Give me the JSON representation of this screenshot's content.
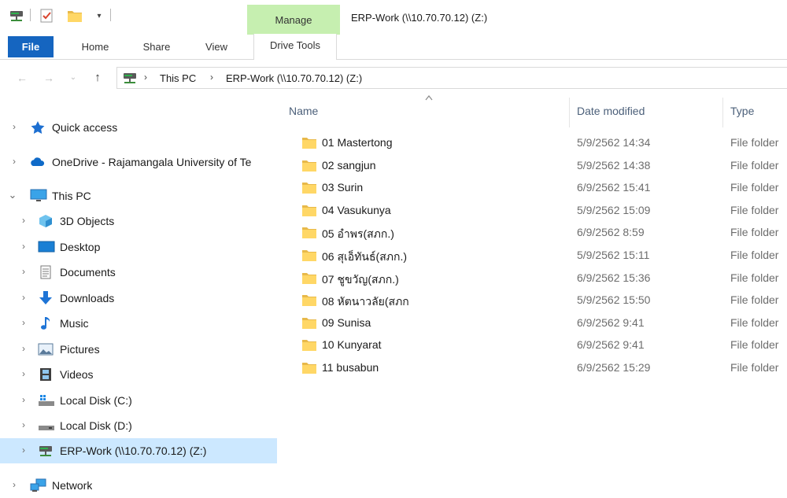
{
  "window": {
    "title": "ERP-Work (\\\\10.70.70.12) (Z:)",
    "contextual_tab_group": "Manage",
    "quick_access_toolbar": [
      "network-drive-icon",
      "properties-icon",
      "new-folder-icon",
      "customize-dropdown-icon"
    ]
  },
  "ribbon": {
    "tabs": [
      "File",
      "Home",
      "Share",
      "View",
      "Drive Tools"
    ],
    "active_color": "#1565c0",
    "contextual_color": "#c6efb0"
  },
  "address_bar": {
    "crumbs": [
      "This PC",
      "ERP-Work (\\\\10.70.70.12) (Z:)"
    ]
  },
  "nav_pane": {
    "items": [
      {
        "label": "Quick access",
        "icon": "star-icon",
        "expanded": false
      },
      {
        "label": "OneDrive - Rajamangala University of Te",
        "icon": "cloud-icon",
        "expanded": false
      },
      {
        "label": "This PC",
        "icon": "monitor-icon",
        "expanded": true
      },
      {
        "label": "3D Objects",
        "icon": "cube-icon",
        "expanded": false
      },
      {
        "label": "Desktop",
        "icon": "desktop-icon",
        "expanded": false
      },
      {
        "label": "Documents",
        "icon": "document-icon",
        "expanded": false
      },
      {
        "label": "Downloads",
        "icon": "download-arrow-icon",
        "expanded": false
      },
      {
        "label": "Music",
        "icon": "music-note-icon",
        "expanded": false
      },
      {
        "label": "Pictures",
        "icon": "picture-icon",
        "expanded": false
      },
      {
        "label": "Videos",
        "icon": "film-icon",
        "expanded": false
      },
      {
        "label": "Local Disk (C:)",
        "icon": "windows-drive-icon",
        "expanded": false
      },
      {
        "label": "Local Disk (D:)",
        "icon": "drive-icon",
        "expanded": false
      },
      {
        "label": "ERP-Work (\\\\10.70.70.12) (Z:)",
        "icon": "network-drive-icon",
        "expanded": false,
        "selected": true
      },
      {
        "label": "Network",
        "icon": "network-icon",
        "expanded": false
      }
    ],
    "selected_color": "#cce8ff"
  },
  "columns": {
    "name": "Name",
    "date": "Date modified",
    "type": "Type"
  },
  "files": [
    {
      "name": "01 Mastertong",
      "date": "5/9/2562 14:34",
      "type": "File folder"
    },
    {
      "name": "02 sangjun",
      "date": "5/9/2562 14:38",
      "type": "File folder"
    },
    {
      "name": "03 Surin",
      "date": "6/9/2562 15:41",
      "type": "File folder"
    },
    {
      "name": "04 Vasukunya",
      "date": "5/9/2562 15:09",
      "type": "File folder"
    },
    {
      "name": "05 อำพร(สภก.)",
      "date": "6/9/2562 8:59",
      "type": "File folder"
    },
    {
      "name": "06 สุเอ็ทันธ์(สภก.)",
      "date": "5/9/2562 15:11",
      "type": "File folder"
    },
    {
      "name": "07 ชูขวัญ(สภก.)",
      "date": "6/9/2562 15:36",
      "type": "File folder"
    },
    {
      "name": "08 หัตนาวลัย(สภก",
      "date": "5/9/2562 15:50",
      "type": "File folder"
    },
    {
      "name": "09 Sunisa",
      "date": "6/9/2562 9:41",
      "type": "File folder"
    },
    {
      "name": "10 Kunyarat",
      "date": "6/9/2562 9:41",
      "type": "File folder"
    },
    {
      "name": "11 busabun",
      "date": "6/9/2562 15:29",
      "type": "File folder"
    }
  ]
}
